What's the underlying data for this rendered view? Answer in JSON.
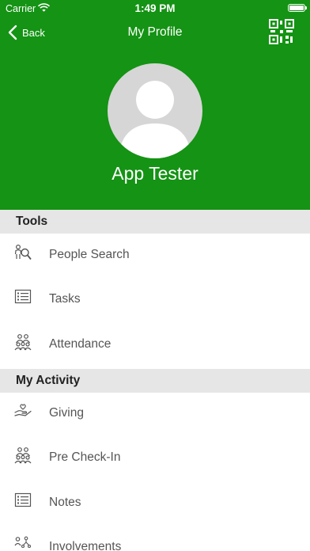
{
  "status_bar": {
    "carrier": "Carrier",
    "time": "1:49 PM"
  },
  "nav": {
    "back_label": "Back",
    "title": "My Profile"
  },
  "profile": {
    "name": "App Tester"
  },
  "sections": [
    {
      "title": "Tools",
      "items": [
        {
          "label": "People Search",
          "icon": "people-search-icon"
        },
        {
          "label": "Tasks",
          "icon": "list-icon"
        },
        {
          "label": "Attendance",
          "icon": "group-icon"
        }
      ]
    },
    {
      "title": "My Activity",
      "items": [
        {
          "label": "Giving",
          "icon": "giving-hand-icon"
        },
        {
          "label": "Pre Check-In",
          "icon": "group-icon"
        },
        {
          "label": "Notes",
          "icon": "list-icon"
        },
        {
          "label": "Involvements",
          "icon": "involvements-icon"
        }
      ]
    }
  ],
  "colors": {
    "header_green": "#149314",
    "section_bg": "#e6e6e6"
  }
}
